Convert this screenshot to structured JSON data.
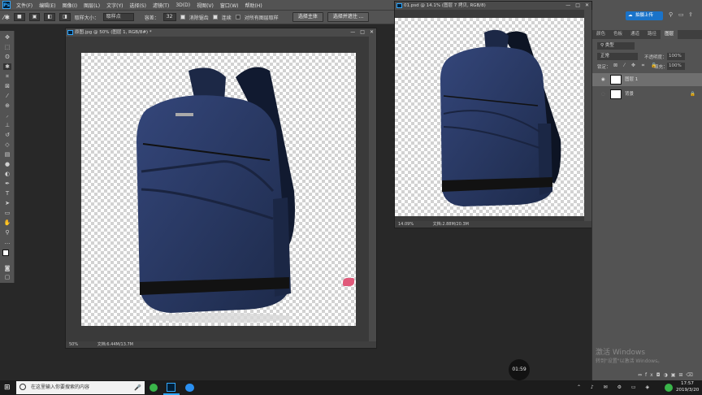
{
  "menubar": {
    "logo": "Ps",
    "items": [
      "文件(F)",
      "编辑(E)",
      "图像(I)",
      "图层(L)",
      "文字(Y)",
      "选择(S)",
      "滤镜(T)",
      "3D(D)",
      "视图(V)",
      "窗口(W)",
      "帮助(H)"
    ],
    "window_min": "—",
    "window_max": "□",
    "window_close": "✕"
  },
  "options": {
    "sample_size_label": "取样大小：",
    "sample_size_value": "取样点",
    "tolerance_label": "容差：",
    "tolerance_value": "32",
    "antialias_label": "消除锯齿",
    "contiguous_label": "连续",
    "sample_all_label": "对所有图层取样",
    "select_subject_button": "选择主体",
    "select_mask_button": "选择并遮住 ..."
  },
  "doc1": {
    "title": "原图.jpg @ 50% (图层 1, RGB/8#) *",
    "zoom": "50%",
    "info": "文档:6.44M/13.7M"
  },
  "doc2": {
    "title": "01.psd @ 14.1% (图层 7 拷贝, RGB/8)",
    "zoom": "14.09%",
    "info": "文档:2.88M/20.3M"
  },
  "panels": {
    "share_button": "拍摄上传",
    "tabs": [
      "颜色",
      "色板",
      "通道",
      "路径",
      "图层"
    ],
    "active_tab": "图层",
    "kind_label": "类型",
    "blend_mode": "正常",
    "opacity_label": "不透明度：",
    "opacity_value": "100%",
    "lock_label": "锁定：",
    "fill_label": "填充：",
    "fill_value": "100%",
    "layers": [
      {
        "name": "图层 1",
        "visible": true,
        "selected": true
      },
      {
        "name": "背景",
        "visible": false,
        "selected": false
      }
    ]
  },
  "watermark": {
    "title": "激活 Windows",
    "subtitle": "转到\"设置\"以激活 Windows。"
  },
  "timer": "01:59",
  "taskbar": {
    "search_placeholder": "在这里输入你要搜索的内容",
    "time": "17:57",
    "date": "2019/3/20"
  },
  "colors": {
    "ui_dark": "#282828",
    "ui_panel": "#535353",
    "backpack": "#27385e",
    "accent": "#31a8ff"
  }
}
